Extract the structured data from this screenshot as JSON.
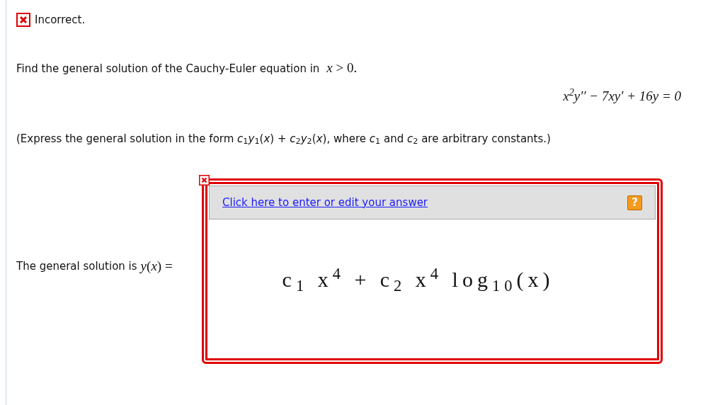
{
  "status": {
    "kind": "incorrect",
    "text": "Incorrect."
  },
  "question": {
    "prompt": "Find the general solution of the Cauchy-Euler equation in",
    "condition": "*x* > 0.",
    "equation": "x$^{2}$y′′ − 7xy′ + 16y = 0",
    "instruction": "(Express the general solution in the form *c*$_{1}$*y*$_{1}$(*x*) + *c*$_{2}$*y*$_{2}$(*x*), where *c*$_{1}$ and *c*$_{2}$ are arbitrary constants.)"
  },
  "answer": {
    "label": "The general solution is",
    "label_math": "*y*(*x*) =",
    "correct": false,
    "edit_link": "Click here to enter or edit your answer",
    "help": "?",
    "value": "c$_{1}$ x$^{4}$ + c$_{2}$ x$^{4}$ log$_{10}$(x)"
  }
}
